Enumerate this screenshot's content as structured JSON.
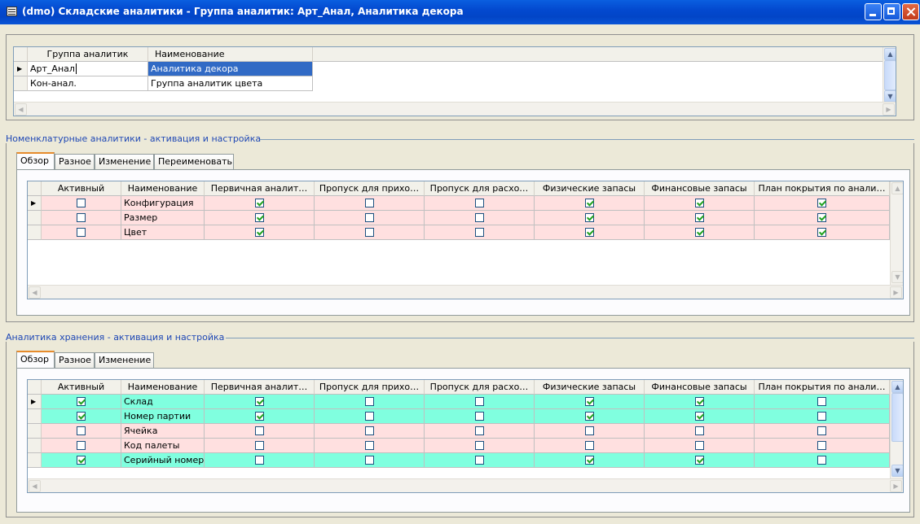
{
  "window": {
    "title": "(dmo) Складские аналитики - Группа аналитик: Арт_Анал, Аналитика декора"
  },
  "groups_grid": {
    "columns": [
      "Группа аналитик",
      "Наименование"
    ],
    "rows": [
      {
        "group": "Арт_Анал",
        "name": "Аналитика декора",
        "current": true
      },
      {
        "group": "Кон-анал.",
        "name": "Группа аналитик цвета",
        "current": false
      }
    ]
  },
  "item_dimensions": {
    "label": "Номенклатурные аналитики - активация и настройка",
    "tabs": [
      "Обзор",
      "Разное",
      "Изменение",
      "Переименовать"
    ],
    "active_tab": "Обзор",
    "columns": [
      "Активный",
      "Наименование",
      "Первичная аналит…",
      "Пропуск для прихо…",
      "Пропуск для расхо…",
      "Физические запасы",
      "Финансовые запасы",
      "План покрытия по анали…"
    ],
    "rows": [
      {
        "name": "Конфигурация",
        "active": false,
        "primary": true,
        "skip_in": false,
        "skip_out": false,
        "physical": true,
        "financial": true,
        "coverage": true,
        "color": "pink",
        "current": true
      },
      {
        "name": "Размер",
        "active": false,
        "primary": true,
        "skip_in": false,
        "skip_out": false,
        "physical": true,
        "financial": true,
        "coverage": true,
        "color": "pink",
        "current": false
      },
      {
        "name": "Цвет",
        "active": false,
        "primary": true,
        "skip_in": false,
        "skip_out": false,
        "physical": true,
        "financial": true,
        "coverage": true,
        "color": "pink",
        "current": false
      }
    ]
  },
  "storage_dimensions": {
    "label": "Аналитика хранения - активация и настройка",
    "tabs": [
      "Обзор",
      "Разное",
      "Изменение"
    ],
    "active_tab": "Обзор",
    "columns": [
      "Активный",
      "Наименование",
      "Первичная аналит…",
      "Пропуск для прихо…",
      "Пропуск для расхо…",
      "Физические запасы",
      "Финансовые запасы",
      "План покрытия по анали…"
    ],
    "rows": [
      {
        "name": "Склад",
        "active": true,
        "primary": true,
        "skip_in": false,
        "skip_out": false,
        "physical": true,
        "financial": true,
        "coverage": false,
        "color": "aqua",
        "current": true
      },
      {
        "name": "Номер партии",
        "active": true,
        "primary": true,
        "skip_in": false,
        "skip_out": false,
        "physical": true,
        "financial": true,
        "coverage": false,
        "color": "aqua",
        "current": false
      },
      {
        "name": "Ячейка",
        "active": false,
        "primary": false,
        "skip_in": false,
        "skip_out": false,
        "physical": false,
        "financial": false,
        "coverage": false,
        "color": "pink",
        "current": false
      },
      {
        "name": "Код палеты",
        "active": false,
        "primary": false,
        "skip_in": false,
        "skip_out": false,
        "physical": false,
        "financial": false,
        "coverage": false,
        "color": "pink",
        "current": false
      },
      {
        "name": "Серийный номер",
        "active": true,
        "primary": false,
        "skip_in": false,
        "skip_out": false,
        "physical": true,
        "financial": true,
        "coverage": false,
        "color": "aqua",
        "current": false
      }
    ]
  },
  "colors": {
    "pink_row": "#ffe0e0",
    "aqua_row": "#80ffdf",
    "selection": "#316ac5",
    "section_label": "#1f48b5",
    "title_bar": "#0349cf"
  }
}
